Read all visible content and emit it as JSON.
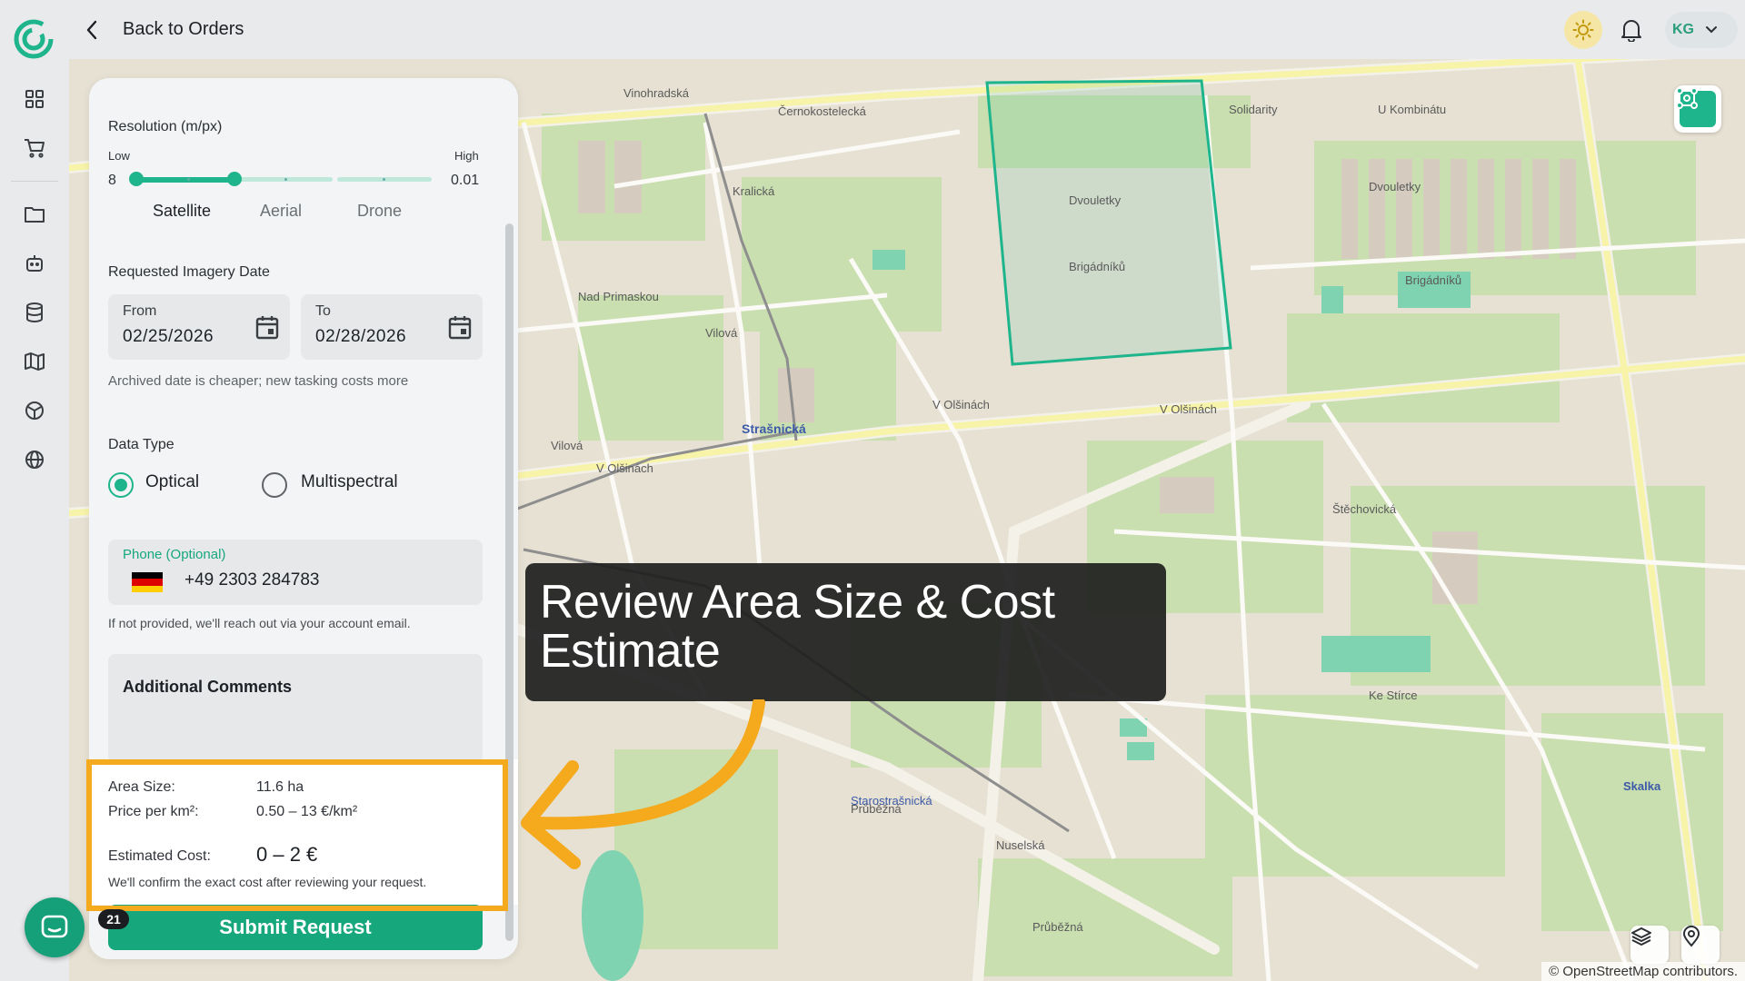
{
  "header": {
    "back_label": "Back to Orders",
    "user_initials": "KG"
  },
  "form": {
    "resolution": {
      "title": "Resolution (m/px)",
      "low_label": "Low",
      "high_label": "High",
      "min_value": "8",
      "max_value": "0.01",
      "sources": [
        "Satellite",
        "Aerial",
        "Drone"
      ],
      "selected_source": "Satellite",
      "slider_fraction": 0.3
    },
    "imagery_date": {
      "title": "Requested Imagery Date",
      "from_label": "From",
      "from_value": "02/25/2026",
      "to_label": "To",
      "to_value": "02/28/2026",
      "hint": "Archived date is cheaper; new tasking costs more"
    },
    "data_type": {
      "title": "Data Type",
      "options": [
        "Optical",
        "Multispectral"
      ],
      "selected": "Optical"
    },
    "phone": {
      "label": "Phone (Optional)",
      "value": "+49 2303 284783",
      "hint": "If not provided, we'll reach out via your account email."
    },
    "comments": {
      "label": "Additional Comments"
    },
    "cost": {
      "area_label": "Area Size:",
      "area_value": "11.6 ha",
      "price_label": "Price per km²:",
      "price_value": "0.50 – 13 €/km²",
      "estimate_label": "Estimated Cost:",
      "estimate_value": "0 – 2 €",
      "note": "We'll confirm the exact cost after reviewing your request."
    },
    "submit_label": "Submit Request"
  },
  "annotation": {
    "callout_text": "Review Area Size & Cost Estimate"
  },
  "chat": {
    "badge_count": "21"
  },
  "map": {
    "attribution": "© OpenStreetMap contributors.",
    "street_labels": [
      "Vinohradská",
      "Černokostelecká",
      "V Olšinách",
      "Strašnická",
      "Dvouletky",
      "Brigádníků",
      "Nad Primaskou",
      "Vilová",
      "Průběžná",
      "Starostrašnická",
      "U Kombinátu",
      "Solidarity",
      "Kralická",
      "Nuselská",
      "Štěchovická",
      "Skalka",
      "Ke Stírce"
    ]
  },
  "colors": {
    "accent": "#1fb58c",
    "highlight": "#f5a91d",
    "theme_button": "#f6e6a6"
  }
}
